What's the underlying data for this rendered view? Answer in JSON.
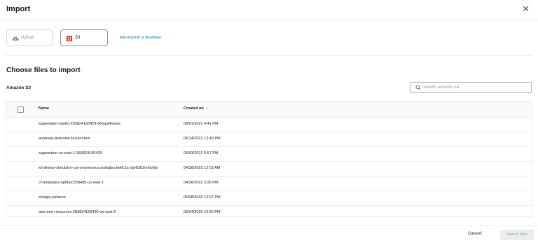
{
  "dialog": {
    "title": "Import",
    "close_glyph": "✕"
  },
  "sources": {
    "upload_label": "Upload",
    "s3_label": "S3",
    "add_link": "Add Redshift or Snowflake",
    "s3_accent": "#d13212"
  },
  "main": {
    "section_title": "Choose files to import",
    "bucket_source": "Amazon S3",
    "search_placeholder": "Search Amazon S3"
  },
  "table": {
    "columns": [
      "Name",
      "Created on"
    ],
    "sort_glyph": "↓",
    "rows": [
      {
        "name": "sagemaker-studio-283824160429-66nips41wws",
        "created": "08/01/2022 4:41 PM"
      },
      {
        "name": "anomaly-detection-bucket-test",
        "created": "06/14/2022 12:49 PM"
      },
      {
        "name": "sagemaker-us-east-1-283824160429",
        "created": "05/03/2022 5:57 PM"
      },
      {
        "name": "iot-device-simulator-commonresourceslogbucketfc1a-1jw82h2mhchbv",
        "created": "04/28/2022 12:03 AM"
      },
      {
        "name": "cf-templates-ophboc2584d5-us-east-1",
        "created": "04/26/2022 3:28 PM"
      },
      {
        "name": "shoppy-pictures",
        "created": "05/08/2020 12:07 PM"
      },
      {
        "name": "aws-emr-resources-283824160429-us-east-2",
        "created": "03/24/2020 10:50 PM"
      }
    ]
  },
  "footer": {
    "cancel_label": "Cancel",
    "import_label": "Import data"
  }
}
